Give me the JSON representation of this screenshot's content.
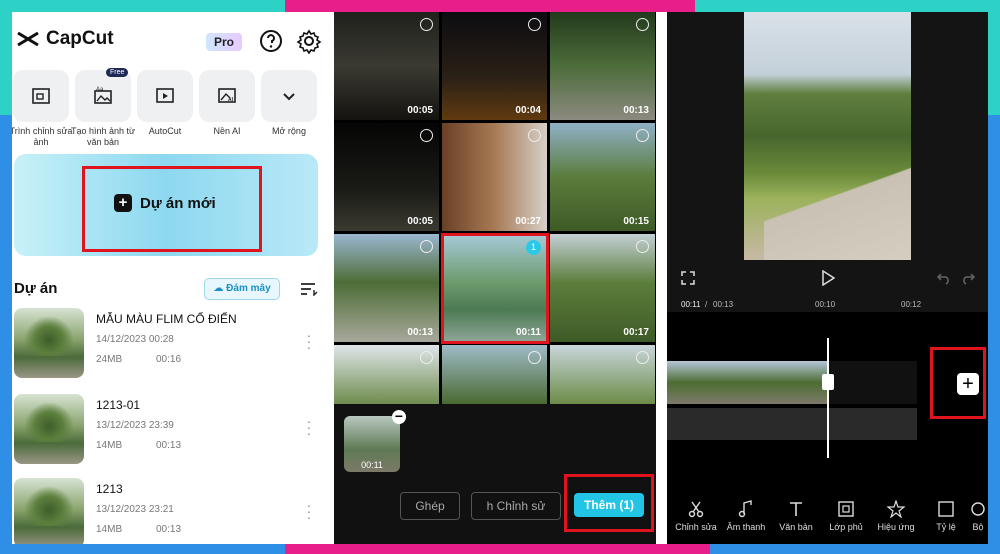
{
  "colors": {
    "red_highlight": "#e0141e",
    "accent_cyan": "#22c5e6",
    "frame_cyan": "#2ed1c6",
    "frame_pink": "#e81f8b",
    "frame_blue": "#2f8fe6"
  },
  "home": {
    "app_name": "CapCut",
    "pro_badge": "Pro",
    "tools": [
      {
        "label": "Trình chỉnh sửa ảnh",
        "icon": "photo-edit-icon"
      },
      {
        "label": "Tạo hình ảnh từ văn bản",
        "icon": "text-to-image-icon",
        "badge": "Free"
      },
      {
        "label": "AutoCut",
        "icon": "autocut-icon"
      },
      {
        "label": "Nền AI",
        "icon": "ai-background-icon"
      },
      {
        "label": "Mở rộng",
        "icon": "chevron-down-icon"
      }
    ],
    "new_project_label": "Dự án mới",
    "projects_title": "Dự án",
    "cloud_label": "Đám mây",
    "projects": [
      {
        "title": "MẪU MÀU FLIM CỔ ĐIỂN",
        "date": "14/12/2023 00:28",
        "size": "24MB",
        "duration": "00:16"
      },
      {
        "title": "1213-01",
        "date": "13/12/2023 23:39",
        "size": "14MB",
        "duration": "00:13"
      },
      {
        "title": "1213",
        "date": "13/12/2023 23:21",
        "size": "14MB",
        "duration": "00:13"
      }
    ]
  },
  "gallery": {
    "durations": [
      "00:05",
      "00:04",
      "00:13",
      "00:05",
      "00:27",
      "00:15",
      "00:13",
      "00:11",
      "00:17"
    ],
    "selected_badge": "1",
    "selected_duration": "00:11",
    "btn_merge": "Ghép",
    "btn_edit": "h  Chỉnh sử",
    "btn_add": "Thêm (1)"
  },
  "editor": {
    "time_current": "00:11",
    "time_total": "00:13",
    "ruler_marks": [
      "00:10",
      "00:12"
    ],
    "toolbar": [
      "Chỉnh sửa",
      "Âm thanh",
      "Văn bản",
      "Lớp phủ",
      "Hiệu ứng",
      "Tỷ lệ",
      "Bộ"
    ]
  }
}
